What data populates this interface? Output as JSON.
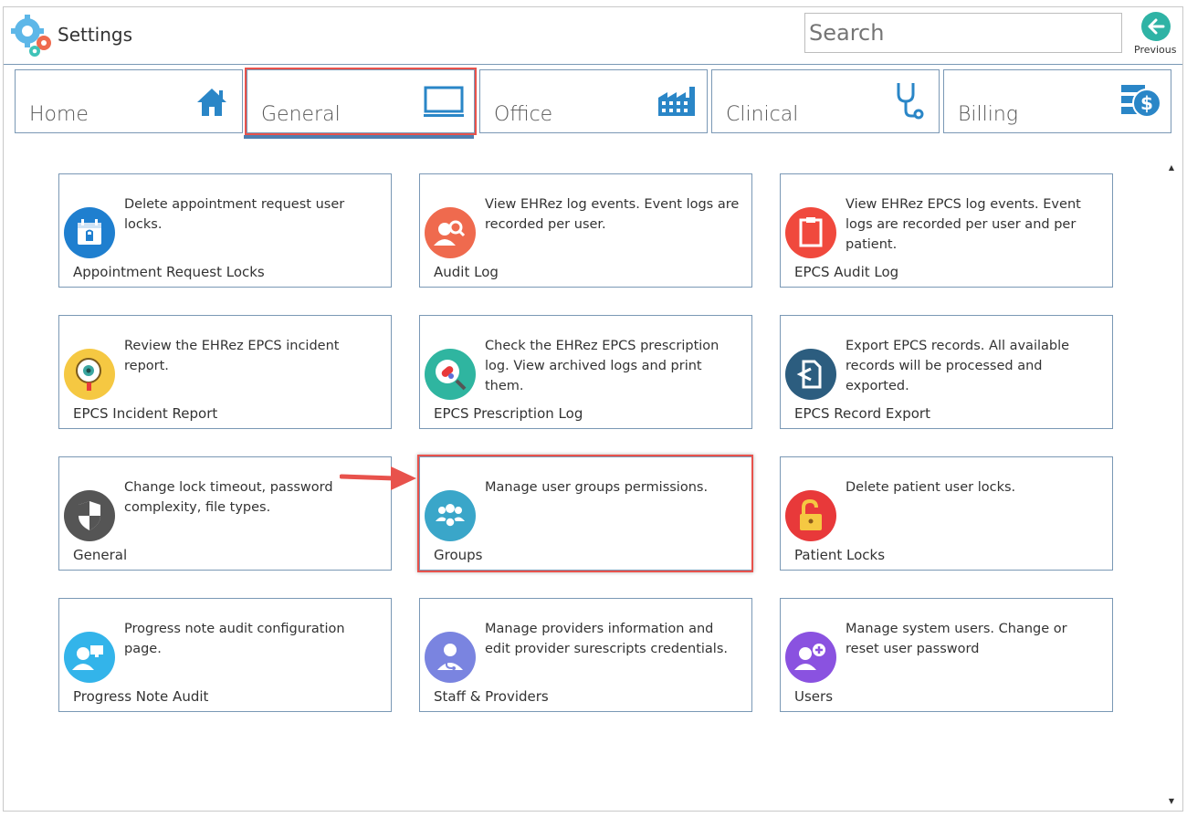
{
  "header": {
    "title": "Settings",
    "search_placeholder": "Search",
    "previous_label": "Previous"
  },
  "tabs": [
    {
      "label": "Home",
      "icon": "home-icon"
    },
    {
      "label": "General",
      "icon": "monitor-icon",
      "selected": true
    },
    {
      "label": "Office",
      "icon": "building-icon"
    },
    {
      "label": "Clinical",
      "icon": "stethoscope-icon"
    },
    {
      "label": "Billing",
      "icon": "billing-icon"
    }
  ],
  "cards": [
    {
      "title": "Appointment Request Locks",
      "desc": "Delete appointment request user locks.",
      "icon": "calendar-lock-icon",
      "color": "#1f7fcf"
    },
    {
      "title": "Audit Log",
      "desc": "View EHRez log events. Event logs are recorded per user.",
      "icon": "user-search-icon",
      "color": "#ef6a4e"
    },
    {
      "title": "EPCS Audit Log",
      "desc": "View EHRez EPCS log events. Event logs are recorded per user and per patient.",
      "icon": "clipboard-icon",
      "color": "#f0493d"
    },
    {
      "title": "EPCS Incident Report",
      "desc": "Review the EHRez EPCS incident report.",
      "icon": "magnifier-eye-icon",
      "color": "#f5c842"
    },
    {
      "title": "EPCS Prescription Log",
      "desc": "Check the EHRez EPCS prescription log. View archived logs and print them.",
      "icon": "pill-search-icon",
      "color": "#2fb5a0"
    },
    {
      "title": "EPCS Record Export",
      "desc": "Export EPCS records. All available records will be processed and exported.",
      "icon": "export-file-icon",
      "color": "#2c5d7f"
    },
    {
      "title": "General",
      "desc": "Change lock timeout, password complexity, file types.",
      "icon": "shield-icon",
      "color": "#555555"
    },
    {
      "title": "Groups",
      "desc": "Manage user groups permissions.",
      "icon": "user-group-icon",
      "color": "#3aa6c9"
    },
    {
      "title": "Patient Locks",
      "desc": "Delete patient user locks.",
      "icon": "padlock-icon",
      "color": "#e8393a"
    },
    {
      "title": "Progress Note Audit",
      "desc": "Progress note audit configuration page.",
      "icon": "user-monitor-icon",
      "color": "#33b4ea"
    },
    {
      "title": "Staff & Providers",
      "desc": "Manage providers information and edit provider surescripts credentials.",
      "icon": "doctor-icon",
      "color": "#7a84e0"
    },
    {
      "title": "Users",
      "desc": "Manage system users. Change or reset user password",
      "icon": "user-add-icon",
      "color": "#8a52e0"
    }
  ],
  "colors": {
    "accent_border": "#7a98b5",
    "highlight": "#e8524c",
    "tab_underline": "#4f7fb0",
    "tab_icon": "#2a86c7"
  }
}
